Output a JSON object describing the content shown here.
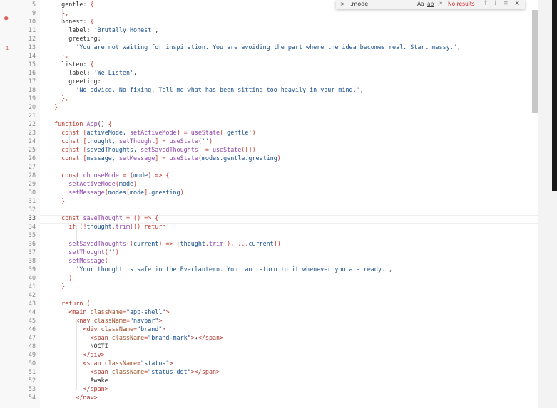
{
  "find": {
    "query": ".mode",
    "match_case_label": "Aa",
    "whole_word_label": "ab",
    "regex_label": ".*",
    "results_text": "No results"
  },
  "gutter": {
    "breakpoint_line": "10",
    "change_marker": "1"
  },
  "lines": [
    {
      "n": "5",
      "tokens": [
        [
          "    gentle: ",
          "plain"
        ],
        [
          "{",
          "punc"
        ]
      ]
    },
    {
      "n": "9",
      "tokens": [
        [
          "    ",
          "plain"
        ],
        [
          "},",
          "punc"
        ]
      ]
    },
    {
      "n": "10",
      "tokens": [
        [
          "    honest: ",
          "plain"
        ],
        [
          "{",
          "punc"
        ]
      ]
    },
    {
      "n": "11",
      "tokens": [
        [
          "      label: ",
          "plain"
        ],
        [
          "'Brutally Honest'",
          "str"
        ],
        [
          ",",
          "plain"
        ]
      ]
    },
    {
      "n": "12",
      "tokens": [
        [
          "      greeting:",
          "plain"
        ]
      ]
    },
    {
      "n": "13",
      "tokens": [
        [
          "        ",
          "plain"
        ],
        [
          "'You are not waiting for inspiration. You are avoiding the part where the idea becomes real. Start messy.'",
          "str"
        ],
        [
          ",",
          "plain"
        ]
      ]
    },
    {
      "n": "14",
      "tokens": [
        [
          "    ",
          "plain"
        ],
        [
          "},",
          "punc"
        ]
      ]
    },
    {
      "n": "15",
      "tokens": [
        [
          "    listen: ",
          "plain"
        ],
        [
          "{",
          "punc"
        ]
      ]
    },
    {
      "n": "16",
      "tokens": [
        [
          "      label: ",
          "plain"
        ],
        [
          "'We Listen'",
          "str"
        ],
        [
          ",",
          "plain"
        ]
      ]
    },
    {
      "n": "17",
      "tokens": [
        [
          "      greeting:",
          "plain"
        ]
      ]
    },
    {
      "n": "18",
      "tokens": [
        [
          "        ",
          "plain"
        ],
        [
          "'No advice. No fixing. Tell me what has been sitting too heavily in your mind.'",
          "str"
        ],
        [
          ",",
          "plain"
        ]
      ]
    },
    {
      "n": "19",
      "tokens": [
        [
          "    ",
          "plain"
        ],
        [
          "},",
          "punc"
        ]
      ]
    },
    {
      "n": "20",
      "tokens": [
        [
          "  ",
          "plain"
        ],
        [
          "}",
          "punc"
        ]
      ]
    },
    {
      "n": "21",
      "tokens": []
    },
    {
      "n": "22",
      "tokens": [
        [
          "  ",
          "plain"
        ],
        [
          "function ",
          "kw"
        ],
        [
          "App",
          "fn"
        ],
        [
          "() ",
          "plain"
        ],
        [
          "{",
          "punc"
        ]
      ]
    },
    {
      "n": "23",
      "tokens": [
        [
          "    ",
          "plain"
        ],
        [
          "const ",
          "kw"
        ],
        [
          "[",
          "punc"
        ],
        [
          "activeMode, ",
          "str"
        ],
        [
          "setActiveMode",
          "fn"
        ],
        [
          "] = ",
          "punc"
        ],
        [
          "useState",
          "fn"
        ],
        [
          "(",
          "punc"
        ],
        [
          "'gentle'",
          "str"
        ],
        [
          ")",
          "punc"
        ]
      ]
    },
    {
      "n": "24",
      "tokens": [
        [
          "    ",
          "plain"
        ],
        [
          "const ",
          "kw"
        ],
        [
          "[",
          "punc"
        ],
        [
          "thought, ",
          "str"
        ],
        [
          "setThought",
          "fn"
        ],
        [
          "] = ",
          "punc"
        ],
        [
          "useState",
          "fn"
        ],
        [
          "(",
          "punc"
        ],
        [
          "''",
          "str"
        ],
        [
          ")",
          "punc"
        ]
      ]
    },
    {
      "n": "25",
      "tokens": [
        [
          "    ",
          "plain"
        ],
        [
          "const ",
          "kw"
        ],
        [
          "[",
          "punc"
        ],
        [
          "savedThoughts, ",
          "str"
        ],
        [
          "setSavedThoughts",
          "fn"
        ],
        [
          "] = ",
          "punc"
        ],
        [
          "useState",
          "fn"
        ],
        [
          "([])",
          "punc"
        ]
      ]
    },
    {
      "n": "26",
      "tokens": [
        [
          "    ",
          "plain"
        ],
        [
          "const ",
          "kw"
        ],
        [
          "[",
          "punc"
        ],
        [
          "message, ",
          "str"
        ],
        [
          "setMessage",
          "fn"
        ],
        [
          "] = ",
          "punc"
        ],
        [
          "useState",
          "fn"
        ],
        [
          "(",
          "punc"
        ],
        [
          "modes.gentle.greeting",
          "str"
        ],
        [
          ")",
          "punc"
        ]
      ]
    },
    {
      "n": "27",
      "tokens": []
    },
    {
      "n": "28",
      "tokens": [
        [
          "    ",
          "plain"
        ],
        [
          "const ",
          "kw"
        ],
        [
          "chooseMode",
          "fn"
        ],
        [
          " = (",
          "punc"
        ],
        [
          "mode",
          "str"
        ],
        [
          ") => ",
          "punc"
        ],
        [
          "{",
          "punc"
        ]
      ]
    },
    {
      "n": "29",
      "tokens": [
        [
          "      ",
          "plain"
        ],
        [
          "setActiveMode",
          "fn"
        ],
        [
          "(",
          "punc"
        ],
        [
          "mode",
          "str"
        ],
        [
          ")",
          "punc"
        ]
      ]
    },
    {
      "n": "30",
      "tokens": [
        [
          "      ",
          "plain"
        ],
        [
          "setMessage",
          "fn"
        ],
        [
          "(",
          "punc"
        ],
        [
          "modes",
          "str"
        ],
        [
          "[",
          "punc"
        ],
        [
          "mode",
          "str"
        ],
        [
          "]",
          "punc"
        ],
        [
          ".greeting",
          "str"
        ],
        [
          ")",
          "punc"
        ]
      ]
    },
    {
      "n": "31",
      "tokens": [
        [
          "    ",
          "plain"
        ],
        [
          "}",
          "punc"
        ]
      ]
    },
    {
      "n": "32",
      "tokens": []
    },
    {
      "n": "33",
      "tokens": [
        [
          "    ",
          "plain"
        ],
        [
          "const ",
          "kw"
        ],
        [
          "saveThought",
          "fn"
        ],
        [
          " = () => ",
          "punc"
        ],
        [
          "{",
          "punc"
        ]
      ]
    },
    {
      "n": "34",
      "tokens": [
        [
          "      ",
          "plain"
        ],
        [
          "if ",
          "kw"
        ],
        [
          "(!",
          "punc"
        ],
        [
          "thought",
          "str"
        ],
        [
          ".",
          "punc"
        ],
        [
          "trim",
          "fn"
        ],
        [
          "()) ",
          "punc"
        ],
        [
          "return",
          "kw"
        ]
      ]
    },
    {
      "n": "35",
      "tokens": []
    },
    {
      "n": "36",
      "tokens": [
        [
          "      ",
          "plain"
        ],
        [
          "setSavedThoughts",
          "fn"
        ],
        [
          "((",
          "punc"
        ],
        [
          "current",
          "str"
        ],
        [
          ") => [",
          "punc"
        ],
        [
          "thought",
          "str"
        ],
        [
          ".",
          "punc"
        ],
        [
          "trim",
          "fn"
        ],
        [
          "(), ...",
          "punc"
        ],
        [
          "current",
          "str"
        ],
        [
          "])",
          "punc"
        ]
      ]
    },
    {
      "n": "37",
      "tokens": [
        [
          "      ",
          "plain"
        ],
        [
          "setThought",
          "fn"
        ],
        [
          "(",
          "punc"
        ],
        [
          "''",
          "str"
        ],
        [
          ")",
          "punc"
        ]
      ]
    },
    {
      "n": "38",
      "tokens": [
        [
          "      ",
          "plain"
        ],
        [
          "setMessage",
          "fn"
        ],
        [
          "(",
          "punc"
        ]
      ]
    },
    {
      "n": "39",
      "tokens": [
        [
          "        ",
          "plain"
        ],
        [
          "'Your thought is safe in the Everlantern. You can return to it whenever you are ready.'",
          "str"
        ],
        [
          ",",
          "plain"
        ]
      ]
    },
    {
      "n": "40",
      "tokens": [
        [
          "      ",
          "plain"
        ],
        [
          ")",
          "punc"
        ]
      ]
    },
    {
      "n": "41",
      "tokens": [
        [
          "    ",
          "plain"
        ],
        [
          "}",
          "punc"
        ]
      ]
    },
    {
      "n": "42",
      "tokens": []
    },
    {
      "n": "43",
      "tokens": [
        [
          "    ",
          "plain"
        ],
        [
          "return ",
          "kw"
        ],
        [
          "(",
          "punc"
        ]
      ]
    },
    {
      "n": "44",
      "tokens": [
        [
          "      ",
          "plain"
        ],
        [
          "<main ",
          "tag"
        ],
        [
          "className",
          "attr"
        ],
        [
          "=",
          "punc"
        ],
        [
          "\"app-shell\"",
          "str"
        ],
        [
          ">",
          "tag"
        ]
      ]
    },
    {
      "n": "45",
      "tokens": [
        [
          "        ",
          "plain"
        ],
        [
          "<nav ",
          "tag"
        ],
        [
          "className",
          "attr"
        ],
        [
          "=",
          "punc"
        ],
        [
          "\"navbar\"",
          "str"
        ],
        [
          ">",
          "tag"
        ]
      ]
    },
    {
      "n": "46",
      "tokens": [
        [
          "          ",
          "plain"
        ],
        [
          "<div ",
          "tag"
        ],
        [
          "className",
          "attr"
        ],
        [
          "=",
          "punc"
        ],
        [
          "\"brand\"",
          "str"
        ],
        [
          ">",
          "tag"
        ]
      ]
    },
    {
      "n": "47",
      "tokens": [
        [
          "            ",
          "plain"
        ],
        [
          "<span ",
          "tag"
        ],
        [
          "className",
          "attr"
        ],
        [
          "=",
          "punc"
        ],
        [
          "\"brand-mark\"",
          "str"
        ],
        [
          ">",
          "tag"
        ],
        [
          "✦",
          "plain"
        ],
        [
          "</span>",
          "tag"
        ]
      ]
    },
    {
      "n": "48",
      "tokens": [
        [
          "            NOCTI",
          "plain"
        ]
      ]
    },
    {
      "n": "49",
      "tokens": [
        [
          "          ",
          "plain"
        ],
        [
          "</div>",
          "tag"
        ]
      ]
    },
    {
      "n": "50",
      "tokens": [
        [
          "          ",
          "plain"
        ],
        [
          "<span ",
          "tag"
        ],
        [
          "className",
          "attr"
        ],
        [
          "=",
          "punc"
        ],
        [
          "\"status\"",
          "str"
        ],
        [
          ">",
          "tag"
        ]
      ]
    },
    {
      "n": "51",
      "tokens": [
        [
          "            ",
          "plain"
        ],
        [
          "<span ",
          "tag"
        ],
        [
          "className",
          "attr"
        ],
        [
          "=",
          "punc"
        ],
        [
          "\"status-dot\"",
          "str"
        ],
        [
          "></span>",
          "tag"
        ]
      ]
    },
    {
      "n": "52",
      "tokens": [
        [
          "            Awake",
          "plain"
        ]
      ]
    },
    {
      "n": "53",
      "tokens": [
        [
          "          ",
          "plain"
        ],
        [
          "</span>",
          "tag"
        ]
      ]
    },
    {
      "n": "54",
      "tokens": [
        [
          "        ",
          "plain"
        ],
        [
          "</nav>",
          "tag"
        ]
      ]
    }
  ]
}
